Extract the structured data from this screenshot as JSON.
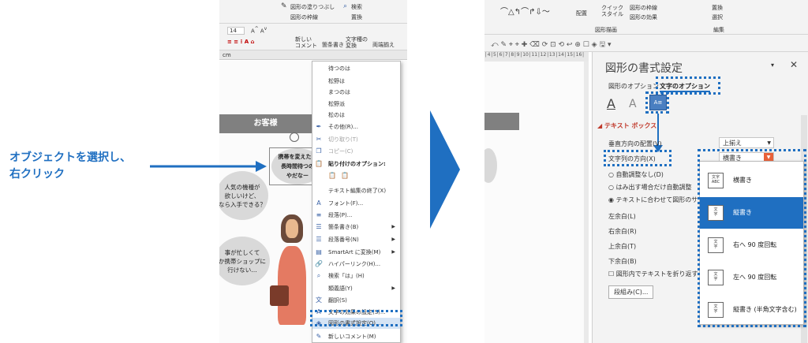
{
  "annotation": {
    "line1": "オブジェクトを選択し、",
    "line2": "右クリック",
    "color": "#1f6fc1"
  },
  "left": {
    "ribbon": {
      "fill_label": "図形の塗りつぶし",
      "outline_label": "図形の枠線",
      "search_label": "検索",
      "replace_label": "置換",
      "font_size": "14",
      "new_comment_label": "新しい\nコメント",
      "bullets_label": "箇条書き",
      "convert_label": "文字種の\n変換",
      "align_label": "両端揃え",
      "unit": "cm"
    },
    "slide": {
      "title": "お客様",
      "speech_1": "携帯を変えたい\n長時間待つの\nやだなー",
      "speech_2": "人気の機種が\n欲しいけど、\nなら入手できる？",
      "speech_3": "事が忙しくて\nか携帯ショップに\n行けない…"
    },
    "context_menu": {
      "items": [
        {
          "label": "待つのは",
          "icon": "",
          "dis": false
        },
        {
          "label": "松野は",
          "icon": "",
          "dis": false
        },
        {
          "label": "まつのは",
          "icon": "",
          "dis": false
        },
        {
          "label": "松野派",
          "icon": "",
          "dis": false
        },
        {
          "label": "松のは",
          "icon": "",
          "dis": false
        },
        {
          "label": "その他(R)...",
          "icon": "✒",
          "dis": false
        },
        {
          "label": "切り取り(T)",
          "icon": "✂",
          "dis": true
        },
        {
          "label": "コピー(C)",
          "icon": "❐",
          "dis": true
        },
        {
          "label": "貼り付けのオプション:",
          "icon": "📋",
          "dis": false,
          "head": true
        },
        {
          "label": "",
          "icon": "",
          "dis": false,
          "paste": true
        },
        {
          "label": "テキスト編集の終了(X)",
          "icon": "",
          "dis": false
        },
        {
          "label": "フォント(F)...",
          "icon": "A",
          "dis": false
        },
        {
          "label": "段落(P)...",
          "icon": "≡",
          "dis": false
        },
        {
          "label": "箇条書き(B)",
          "icon": "☰",
          "dis": false,
          "sub": true
        },
        {
          "label": "段落番号(N)",
          "icon": "☰",
          "dis": false,
          "sub": true
        },
        {
          "label": "SmartArt に変換(M)",
          "icon": "▤",
          "dis": false,
          "sub": true
        },
        {
          "label": "ハイパーリンク(H)...",
          "icon": "🔗",
          "dis": false
        },
        {
          "label": "検索「は」(H)",
          "icon": "⌕",
          "dis": false
        },
        {
          "label": "類義語(Y)",
          "icon": "",
          "dis": false,
          "sub": true
        },
        {
          "label": "翻訳(S)",
          "icon": "文",
          "dis": false
        },
        {
          "label": "文字の効果の設定(S)...",
          "icon": "A",
          "dis": false
        },
        {
          "label": "図形の書式設定(O)...",
          "icon": "◈",
          "dis": false
        },
        {
          "label": "新しいコメント(M)",
          "icon": "✎",
          "dis": false
        }
      ]
    }
  },
  "right": {
    "ribbon": {
      "arrange_label": "配置",
      "quick_style_label": "クイック\nスタイル",
      "outline_label": "図形の枠線",
      "effect_label": "図形の効果",
      "drawing_group": "図形描画",
      "replace_label": "置換",
      "select_label": "選択",
      "edit_group": "編集"
    },
    "panel": {
      "title": "図形の書式設定",
      "tab_shape": "図形のオプション",
      "tab_text": "文字のオプション",
      "section": "テキスト ボックス",
      "vertical_align_label": "垂直方向の配置(V)",
      "vertical_align_value": "上揃え",
      "direction_label": "文字列の方向(X)",
      "direction_value": "横書き",
      "autofit_none": "自動調整なし(D)",
      "autofit_shrink": "はみ出す場合だけ自動調整",
      "autofit_resize": "テキストに合わせて図形のサ",
      "margin_left": "左余白(L)",
      "margin_right": "右余白(R)",
      "margin_top": "上余白(T)",
      "margin_bottom": "下余白(B)",
      "wrap_label": "図形内でテキストを折り返す",
      "columns_button": "段組み(C)..."
    },
    "dropdown": {
      "items": [
        {
          "label": "横書き",
          "icon": "文字\nABC",
          "selected": false
        },
        {
          "label": "縦書き",
          "icon": "",
          "selected": true
        },
        {
          "label": "右へ 90 度回転",
          "icon": "",
          "selected": false
        },
        {
          "label": "左へ 90 度回転",
          "icon": "",
          "selected": false
        },
        {
          "label": "縦書き (半角文字含む)",
          "icon": "文\n字\n",
          "selected": false
        }
      ]
    }
  }
}
